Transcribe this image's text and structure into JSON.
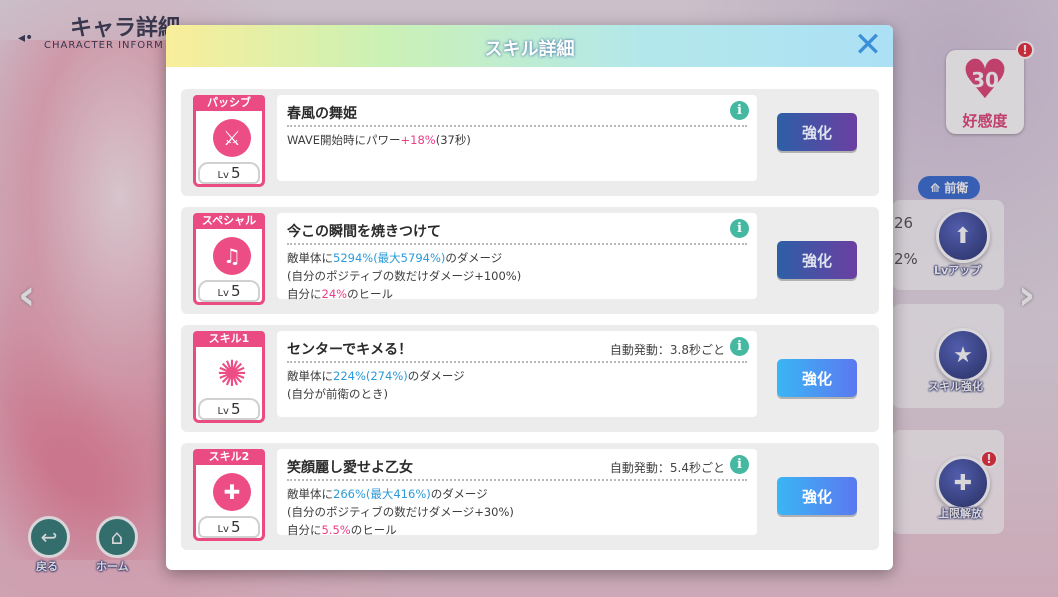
{
  "background": {
    "title": "キャラ詳細",
    "subtitle": "CHARACTER INFORM",
    "affection": {
      "value": "30",
      "label": "好感度"
    },
    "position_tag": "前衛",
    "stats": [
      "26",
      "2%"
    ],
    "side_buttons": [
      "Lvアップ",
      "スキル強化",
      "上限解放"
    ],
    "nav": {
      "back": "戻る",
      "home": "ホーム"
    },
    "badge": "!"
  },
  "modal": {
    "title": "スキル詳細",
    "close_icon": "close-x-icon",
    "upgrade_label": "強化",
    "lv_prefix": "Lv",
    "skills": [
      {
        "type": "パッシブ",
        "icon": "sword-icon",
        "level": "5",
        "name": "春風の舞姫",
        "auto": "",
        "lines": [
          [
            {
              "t": "WAVE開始時にパワー",
              "c": ""
            },
            {
              "t": "+18%",
              "c": "pink"
            },
            {
              "t": "(37秒)",
              "c": ""
            }
          ]
        ],
        "button_state": "dark"
      },
      {
        "type": "スペシャル",
        "icon": "bell-icon",
        "level": "5",
        "name": "今この瞬間を焼きつけて",
        "auto": "",
        "lines": [
          [
            {
              "t": "敵単体に",
              "c": ""
            },
            {
              "t": "5294%(最大5794%)",
              "c": "blue"
            },
            {
              "t": "のダメージ",
              "c": ""
            }
          ],
          [
            {
              "t": "(自分のポジティブの数だけダメージ+100%)",
              "c": ""
            }
          ],
          [
            {
              "t": "自分に",
              "c": ""
            },
            {
              "t": "24%",
              "c": "pink"
            },
            {
              "t": "のヒール",
              "c": ""
            }
          ]
        ],
        "button_state": "dark"
      },
      {
        "type": "スキル1",
        "icon": "burst-icon",
        "level": "5",
        "name": "センターでキメる！",
        "auto": "自動発動：3.8秒ごと",
        "lines": [
          [
            {
              "t": "敵単体に",
              "c": ""
            },
            {
              "t": "224%(274%)",
              "c": "blue"
            },
            {
              "t": "のダメージ",
              "c": ""
            }
          ],
          [
            {
              "t": "(自分が前衛のとき)",
              "c": ""
            }
          ]
        ],
        "button_state": "bright"
      },
      {
        "type": "スキル2",
        "icon": "heart-plus-icon",
        "level": "5",
        "name": "笑顔麗し愛せよ乙女",
        "auto": "自動発動：5.4秒ごと",
        "lines": [
          [
            {
              "t": "敵単体に",
              "c": ""
            },
            {
              "t": "266%(最大416%)",
              "c": "blue"
            },
            {
              "t": "のダメージ",
              "c": ""
            }
          ],
          [
            {
              "t": "(自分のポジティブの数だけダメージ+30%)",
              "c": ""
            }
          ],
          [
            {
              "t": "自分に",
              "c": ""
            },
            {
              "t": "5.5%",
              "c": "pink"
            },
            {
              "t": "のヒール",
              "c": ""
            }
          ]
        ],
        "button_state": "bright"
      }
    ]
  }
}
